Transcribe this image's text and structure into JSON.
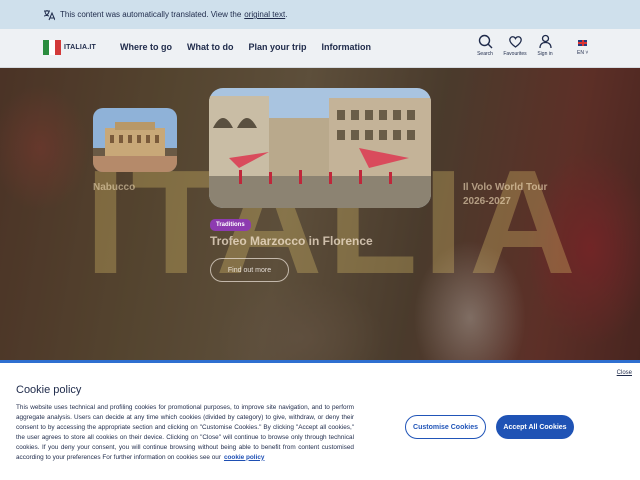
{
  "translation_bar": {
    "text": "This content was automatically translated. View the",
    "link": "original text",
    "suffix": "."
  },
  "header": {
    "logo_text": "ITALIA.IT",
    "nav": [
      "Where to go",
      "What to do",
      "Plan your trip",
      "Information"
    ],
    "tools": {
      "search": "Search",
      "favourites": "Favourites",
      "signin": "Sign in"
    },
    "language": "EN"
  },
  "hero": {
    "background_word": "ITALIA",
    "left_card_caption": "Nabucco",
    "right_card_caption": "Il Volo World Tour 2026-2027",
    "tag": "Traditions",
    "title": "Trofeo Marzocco in Florence",
    "button": "Find out more"
  },
  "cookie": {
    "close": "Close",
    "title": "Cookie policy",
    "text": "This website uses technical and profiling cookies for promotional purposes, to improve site navigation, and to perform aggregate analysis. Users can decide at any time which cookies (divided by category) to give, withdraw, or deny their consent to by accessing the appropriate section and clicking on \"Customise Cookies.\" By clicking \"Accept all cookies,\" the user agrees to store all cookies on their device. Clicking on \"Close\" will continue to browse only through technical cookies. If you deny your consent, you will continue browsing without being able to benefit from content customised according to your preferences For further information on cookies see our",
    "link": "cookie policy",
    "customise_button": "Customise Cookies",
    "accept_button": "Accept All Cookies"
  },
  "colors": {
    "accent": "#1f53b5",
    "tag": "#8d3bb0",
    "banner": "#cfe0ec"
  }
}
